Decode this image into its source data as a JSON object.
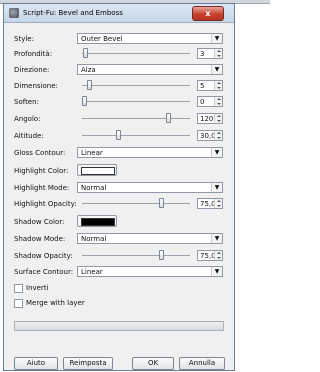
{
  "window": {
    "title": "Script-Fu: Bevel and Emboss",
    "close_glyph": "x"
  },
  "fields": {
    "style": {
      "label": "Style:",
      "value": "Outer Bevel"
    },
    "profondita": {
      "label": "Profondità:",
      "value": "3"
    },
    "direzione": {
      "label": "Direzione:",
      "value": "Alza"
    },
    "dimensione": {
      "label": "Dimensione:",
      "value": "5"
    },
    "soften": {
      "label": "Soften:",
      "value": "0"
    },
    "angolo": {
      "label": "Angolo:",
      "value": "120,0"
    },
    "altitude": {
      "label": "Altitude:",
      "value": "30,0"
    },
    "gloss_contour": {
      "label": "Gloss Contour:",
      "value": "Linear"
    },
    "highlight_color": {
      "label": "Highlight Color:",
      "color": "#ffffff"
    },
    "highlight_mode": {
      "label": "Highlight Mode:",
      "value": "Normal"
    },
    "highlight_opacity": {
      "label": "Highlight Opacity:",
      "value": "75,0"
    },
    "shadow_color": {
      "label": "Shadow Color:",
      "color": "#000000"
    },
    "shadow_mode": {
      "label": "Shadow Mode:",
      "value": "Normal"
    },
    "shadow_opacity": {
      "label": "Shadow Opacity:",
      "value": "75,0"
    },
    "surface_contour": {
      "label": "Surface Contour:",
      "value": "Linear"
    }
  },
  "checkboxes": {
    "inverti": {
      "label": "Inverti",
      "checked": false
    },
    "merge": {
      "label": "Merge with layer",
      "checked": false
    }
  },
  "buttons": {
    "aiuto": "Aiuto",
    "reimposta": "Reimposta",
    "ok": "OK",
    "annulla": "Annulla"
  }
}
